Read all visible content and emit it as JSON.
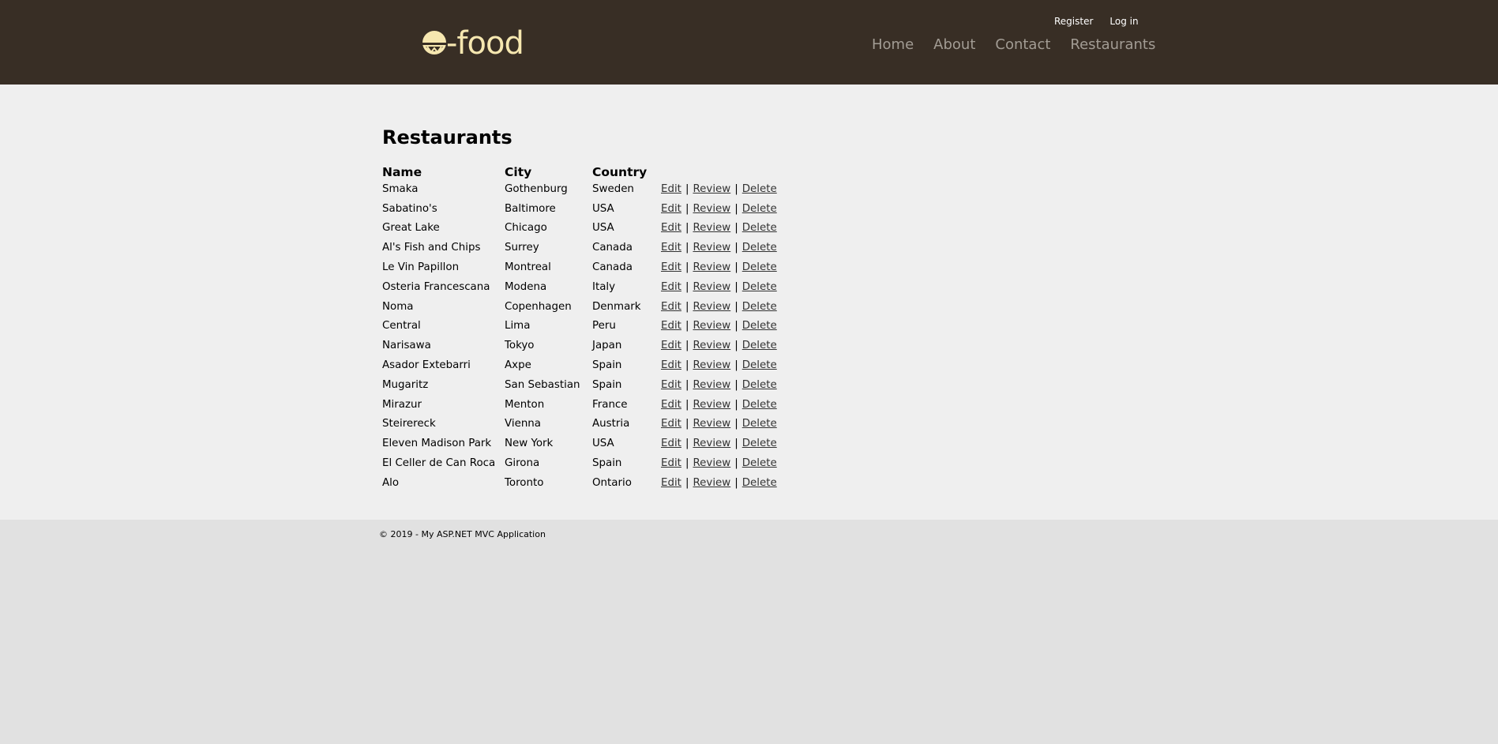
{
  "brand": {
    "logo_text": "-food"
  },
  "account": {
    "register": "Register",
    "login": "Log in"
  },
  "nav": [
    "Home",
    "About",
    "Contact",
    "Restaurants"
  ],
  "page_title": "Restaurants",
  "table": {
    "headers": [
      "Name",
      "City",
      "Country"
    ],
    "actions": {
      "edit": "Edit",
      "review": "Review",
      "delete": "Delete",
      "sep": "|"
    },
    "rows": [
      [
        "Smaka",
        "Gothenburg",
        "Sweden"
      ],
      [
        "Sabatino's",
        "Baltimore",
        "USA"
      ],
      [
        "Great Lake",
        "Chicago",
        "USA"
      ],
      [
        "Al's Fish and Chips",
        "Surrey",
        "Canada"
      ],
      [
        "Le Vin Papillon",
        "Montreal",
        "Canada"
      ],
      [
        "Osteria Francescana",
        "Modena",
        "Italy"
      ],
      [
        "Noma",
        "Copenhagen",
        "Denmark"
      ],
      [
        "Central",
        "Lima",
        "Peru"
      ],
      [
        "Narisawa",
        "Tokyo",
        "Japan"
      ],
      [
        "Asador Extebarri",
        "Axpe",
        "Spain"
      ],
      [
        "Mugaritz",
        "San Sebastian",
        "Spain"
      ],
      [
        "Mirazur",
        "Menton",
        "France"
      ],
      [
        "Steirereck",
        "Vienna",
        "Austria"
      ],
      [
        "Eleven Madison Park",
        "New York",
        "USA"
      ],
      [
        "El Celler de Can Roca",
        "Girona",
        "Spain"
      ],
      [
        "Alo",
        "Toronto",
        "Ontario"
      ]
    ]
  },
  "footer": {
    "text": "© 2019 - My ASP.NET MVC Application"
  },
  "colors": {
    "header_bg": "#382e25",
    "logo": "#f6e7b0",
    "nav": "#a29c94",
    "main_bg": "#efefef",
    "footer_bg": "#e1e1e1"
  }
}
